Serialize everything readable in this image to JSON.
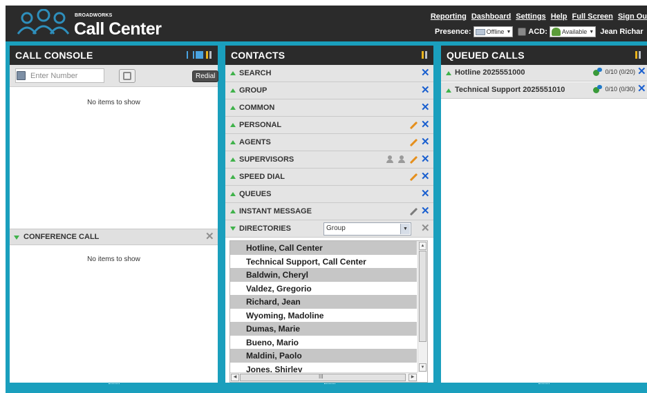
{
  "header": {
    "brand_small": "BROADWORKS",
    "brand_name": "Call Center",
    "links": [
      "Reporting",
      "Dashboard",
      "Settings",
      "Help",
      "Full Screen",
      "Sign Ou"
    ],
    "presence_label": "Presence:",
    "presence_value": "Offline",
    "acd_label": "ACD:",
    "acd_value": "Available",
    "user_name": "Jean Richar"
  },
  "call_console": {
    "title": "CALL CONSOLE",
    "number_placeholder": "Enter Number",
    "redial_label": "Redial",
    "empty_text": "No items to show",
    "conference_title": "CONFERENCE CALL",
    "conference_empty_text": "No items to show"
  },
  "contacts": {
    "title": "CONTACTS",
    "sections": [
      {
        "label": "SEARCH"
      },
      {
        "label": "GROUP"
      },
      {
        "label": "COMMON"
      },
      {
        "label": "PERSONAL"
      },
      {
        "label": "AGENTS"
      },
      {
        "label": "SUPERVISORS"
      },
      {
        "label": "SPEED DIAL"
      },
      {
        "label": "QUEUES"
      },
      {
        "label": "INSTANT MESSAGE"
      },
      {
        "label": "DIRECTORIES"
      }
    ],
    "directory_filter": "Group",
    "directory_entries": [
      "Hotline, Call Center",
      "Technical Support, Call Center",
      "Baldwin, Cheryl",
      "Valdez, Gregorio",
      "Richard, Jean",
      "Wyoming, Madoline",
      "Dumas, Marie",
      "Bueno, Mario",
      "Maldini, Paolo",
      "Jones, Shirley"
    ],
    "scroll_grip": "III"
  },
  "queued_calls": {
    "title": "QUEUED CALLS",
    "queues": [
      {
        "name": "Hotline 2025551000",
        "stats": "0/10 (0/20)"
      },
      {
        "name": "Technical Support 2025551010",
        "stats": "0/10 (0/30)"
      }
    ]
  },
  "colors": {
    "accent": "#1a9fbd",
    "header_bg": "#2b2b2b",
    "expand_green": "#3fb24a",
    "remove_blue": "#1a5fcf"
  },
  "icons": {
    "logo": "people-group-logo-icon",
    "directory": "address-book-icon",
    "dial": "phone-dial-icon",
    "remove": "close-x-icon",
    "edit": "pencil-icon",
    "tools": "wrench-icon"
  }
}
